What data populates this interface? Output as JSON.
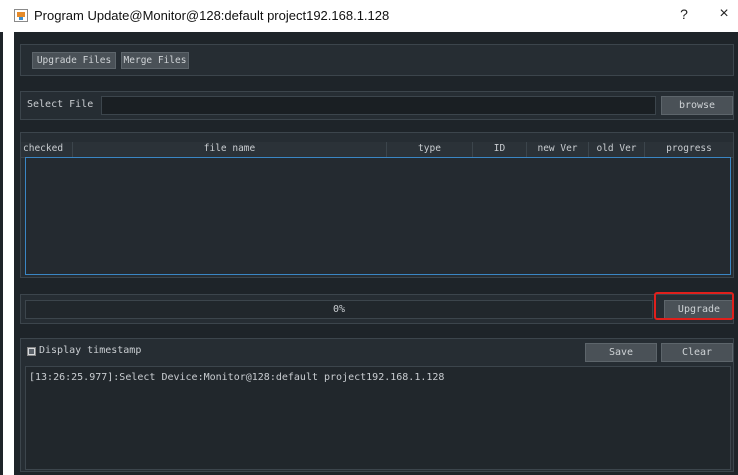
{
  "window": {
    "title": "Program Update@Monitor@128:default project192.168.1.128",
    "help_icon": "?",
    "close_icon": "×"
  },
  "tabs": {
    "upgrade_files": "Upgrade Files",
    "merge_files": "Merge Files"
  },
  "select_file": {
    "label": "Select File",
    "value": "",
    "browse_label": "browse"
  },
  "table": {
    "headers": [
      "checked",
      "file name",
      "type",
      "ID",
      "new Ver",
      "old Ver",
      "progress"
    ],
    "rows": []
  },
  "progress": {
    "value": 0,
    "text": "0%",
    "upgrade_label": "Upgrade"
  },
  "log": {
    "timestamp_label": "Display timestamp",
    "timestamp_checked": true,
    "save_label": "Save",
    "clear_label": "Clear",
    "lines": [
      "[13:26:25.977]:Select Device:Monitor@128:default project192.168.1.128"
    ]
  },
  "colors": {
    "background": "#1e2429",
    "panel": "#262d33",
    "highlight": "#e0201c",
    "table_border": "#3a86c4"
  }
}
